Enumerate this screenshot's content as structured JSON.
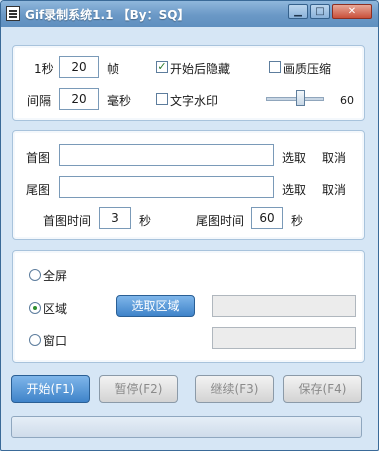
{
  "window": {
    "title": "Gif录制系统1.1 【By：SQ】",
    "minimize_glyph": "▁",
    "maximize_glyph": "□",
    "close_glyph": "✕"
  },
  "capture": {
    "fps_prefix": "1秒",
    "fps_value": "20",
    "fps_unit": "帧",
    "interval_label": "间隔",
    "interval_value": "20",
    "interval_unit": "毫秒",
    "hide_on_start_label": "开始后隐藏",
    "hide_on_start_checked": true,
    "text_watermark_label": "文字水印",
    "text_watermark_checked": false,
    "quality_compress_label": "画质压缩",
    "quality_compress_checked": false,
    "quality_value": "60",
    "quality_level": 0.6
  },
  "images": {
    "first_label": "首图",
    "first_value": "",
    "first_select": "选取",
    "first_cancel": "取消",
    "last_label": "尾图",
    "last_value": "",
    "last_select": "选取",
    "last_cancel": "取消",
    "first_time_label": "首图时间",
    "first_time_value": "3",
    "first_time_unit": "秒",
    "last_time_label": "尾图时间",
    "last_time_value": "60",
    "last_time_unit": "秒"
  },
  "area": {
    "fullscreen_label": "全屏",
    "region_label": "区域",
    "region_selected": true,
    "select_region_button": "选取区域",
    "region_value": "",
    "window_label": "窗口",
    "window_value": ""
  },
  "actions": {
    "start": "开始(F1)",
    "pause": "暂停(F2)",
    "continue": "继续(F3)",
    "save": "保存(F4)"
  },
  "progress": {
    "value": 0
  }
}
